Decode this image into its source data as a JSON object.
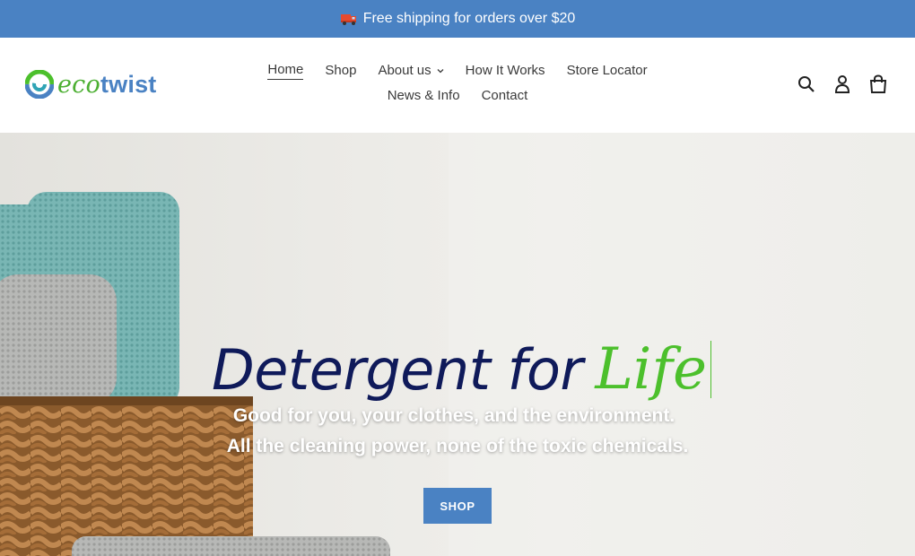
{
  "announcement": {
    "icon": "truck-icon",
    "text": "Free shipping for orders over $20"
  },
  "header": {
    "logo": {
      "eco": "eco",
      "twist": "twist"
    },
    "nav": [
      {
        "label": "Home",
        "active": true
      },
      {
        "label": "Shop"
      },
      {
        "label": "About us",
        "has_dropdown": true
      },
      {
        "label": "How It Works"
      },
      {
        "label": "Store Locator"
      },
      {
        "label": "News & Info"
      },
      {
        "label": "Contact"
      }
    ],
    "icons": [
      "search-icon",
      "account-icon",
      "cart-icon"
    ]
  },
  "hero": {
    "headline": "Detergent for",
    "headline_accent": "Life",
    "subline_1": "Good for you, your clothes, and the environment.",
    "subline_2": "All the cleaning power, none of the toxic chemicals.",
    "cta_label": "SHOP"
  },
  "colors": {
    "brand_blue": "#4a82c3",
    "brand_green": "#4cc02c",
    "headline_navy": "#0f1a5a"
  }
}
